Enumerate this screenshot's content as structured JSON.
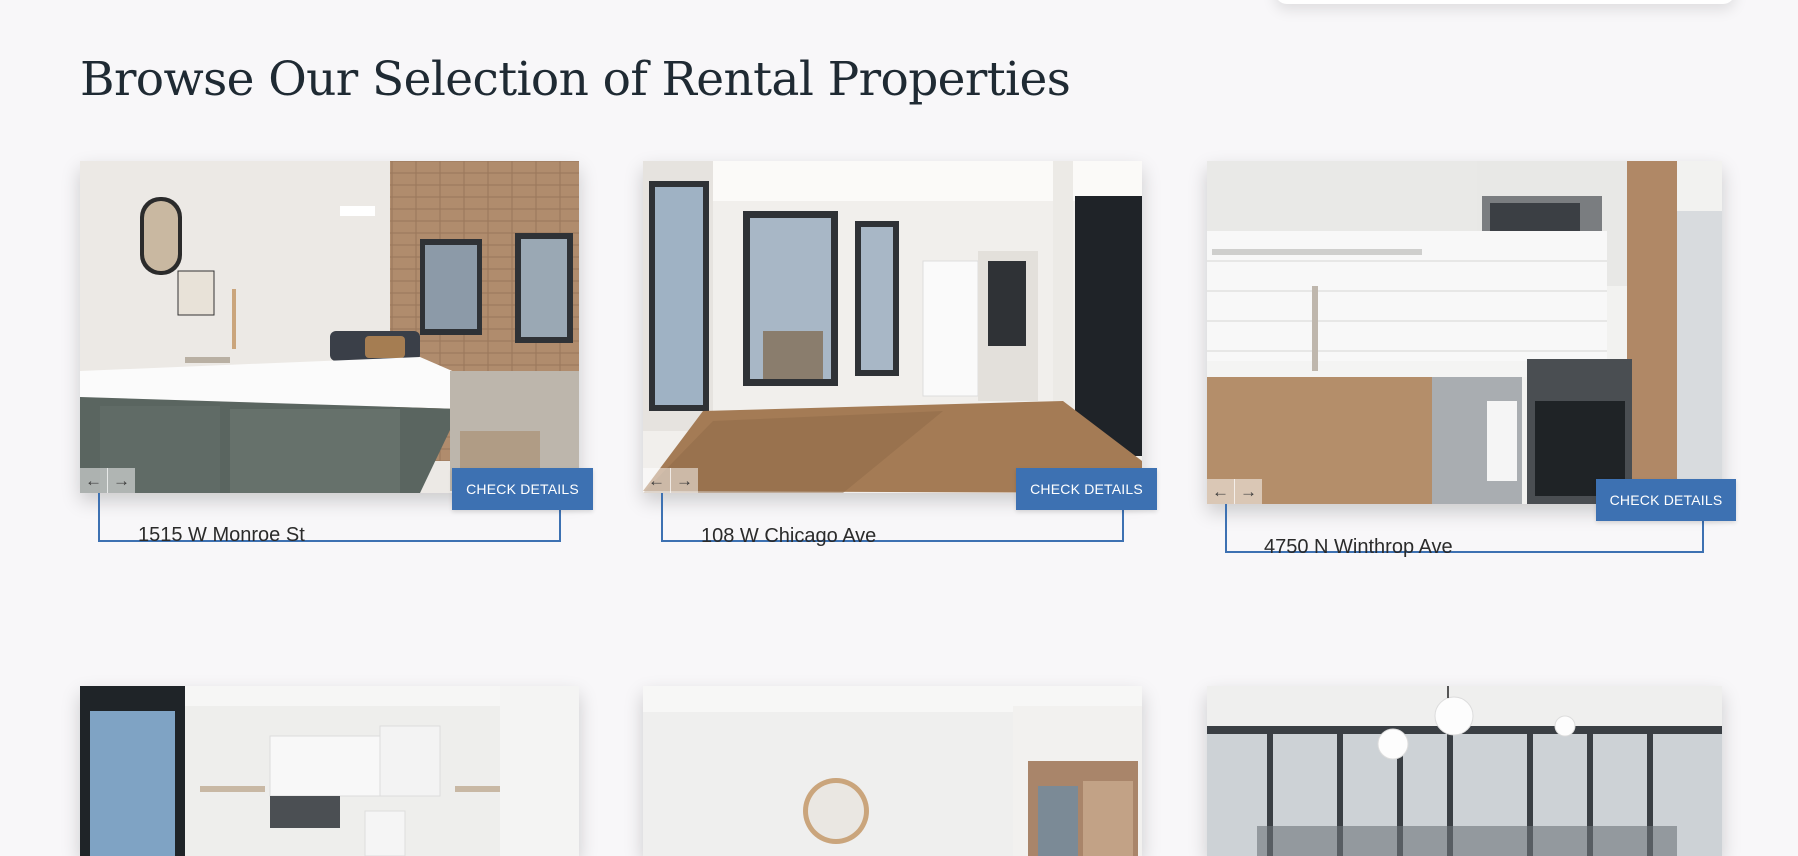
{
  "page": {
    "title": "Browse Our Selection of Rental Properties"
  },
  "nav": {
    "prev_icon": "arrow-left-icon",
    "next_icon": "arrow-right-icon",
    "prev_glyph": "←",
    "next_glyph": "→"
  },
  "properties": [
    {
      "address": "1515 W Monroe St",
      "button_label": "CHECK DETAILS",
      "photo": "kitchen-island-loft"
    },
    {
      "address": "108 W Chicago Ave",
      "button_label": "CHECK DETAILS",
      "photo": "bay-window-room"
    },
    {
      "address": "4750 N Winthrop Ave",
      "button_label": "CHECK DETAILS",
      "photo": "wood-cabinet-kitchen"
    },
    {
      "photo": "white-kitchen"
    },
    {
      "photo": "round-mirror-room"
    },
    {
      "photo": "corner-window-loft"
    }
  ],
  "colors": {
    "accent": "#3d71b2",
    "background": "#f8f7f9",
    "text": "#1f2a33"
  }
}
